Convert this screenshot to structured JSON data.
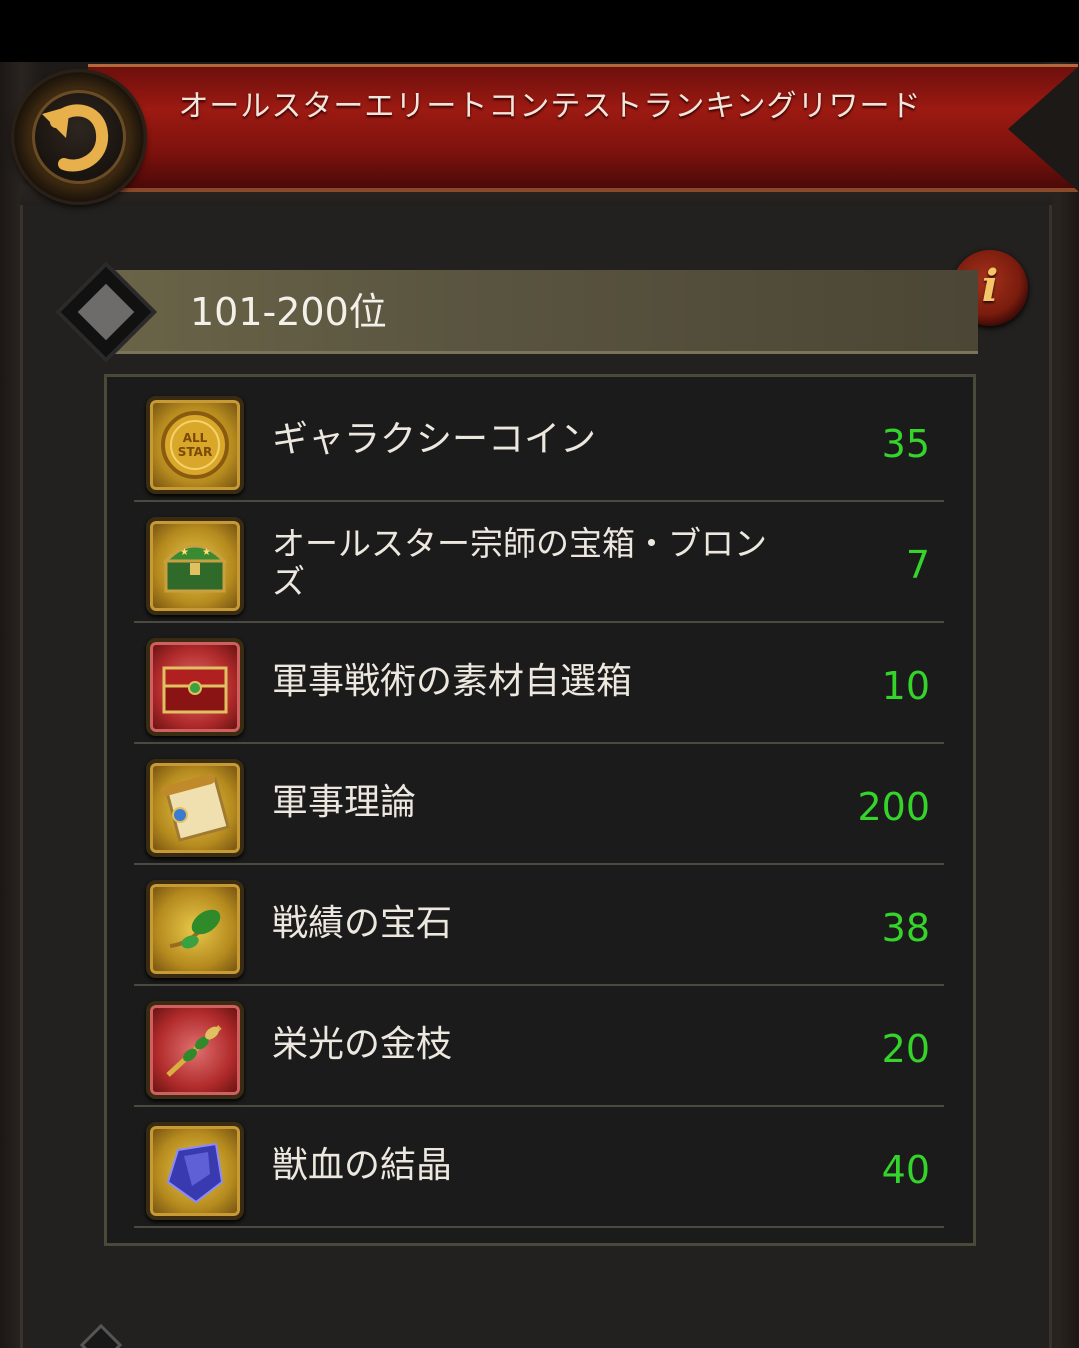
{
  "header": {
    "title": "オールスターエリートコンテストランキングリワード",
    "back_icon": "back-arrow-icon",
    "info_icon": "info-icon",
    "info_glyph": "i"
  },
  "rank": {
    "label": "101-200位"
  },
  "rewards": [
    {
      "name": "ギャラクシーコイン",
      "qty": "35",
      "icon": "galaxy-coin-icon",
      "frame": "gold"
    },
    {
      "name": "オールスター宗師の宝箱・ブロンズ",
      "qty": "7",
      "icon": "bronze-chest-icon",
      "frame": "gold"
    },
    {
      "name": "軍事戦術の素材自選箱",
      "qty": "10",
      "icon": "red-chest-icon",
      "frame": "red"
    },
    {
      "name": "軍事理論",
      "qty": "200",
      "icon": "scroll-icon",
      "frame": "gold"
    },
    {
      "name": "戦績の宝石",
      "qty": "38",
      "icon": "green-gem-icon",
      "frame": "gold"
    },
    {
      "name": "栄光の金枝",
      "qty": "20",
      "icon": "golden-branch-icon",
      "frame": "red"
    },
    {
      "name": "獣血の結晶",
      "qty": "40",
      "icon": "blood-crystal-icon",
      "frame": "gold"
    }
  ],
  "colors": {
    "quantity": "#35d42a",
    "banner": "#9c1a12",
    "rank_bar": "#5a5540"
  }
}
